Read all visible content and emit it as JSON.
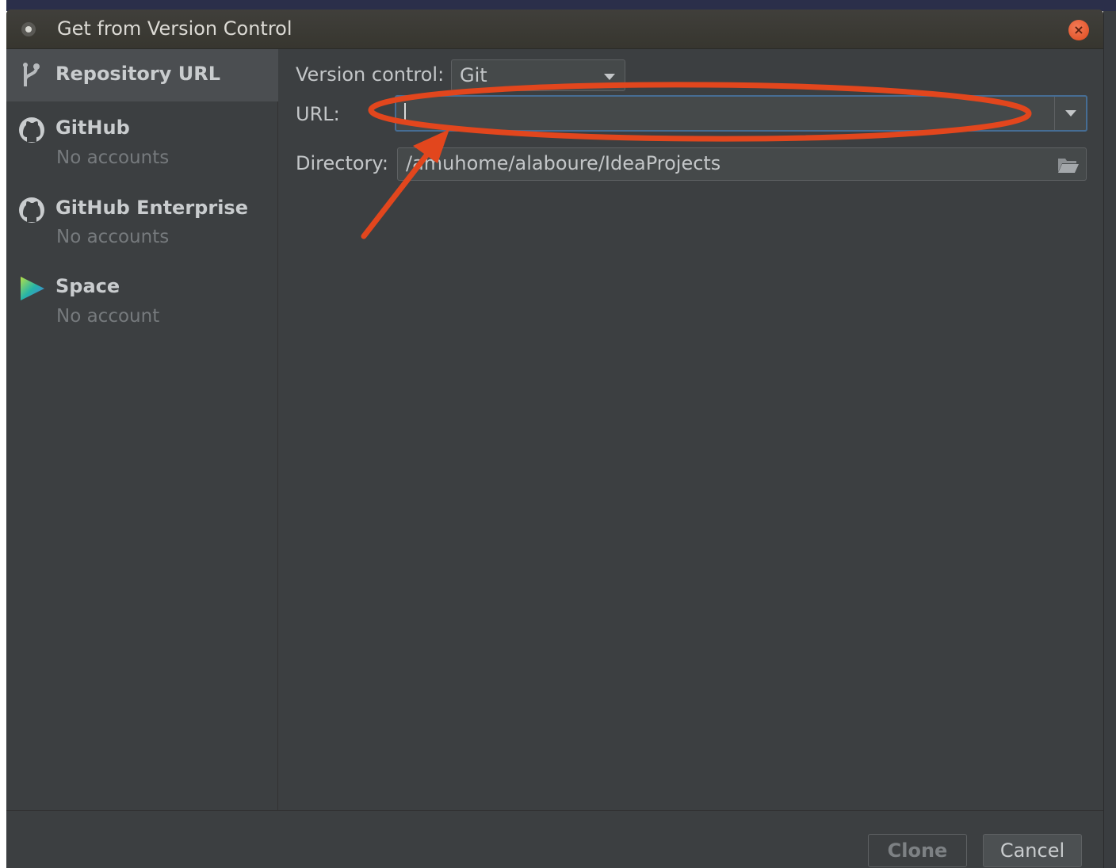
{
  "window": {
    "title": "Get from Version Control",
    "close_glyph": "×"
  },
  "sidebar": {
    "items": [
      {
        "label": "Repository URL",
        "icon": "vcs-branch-icon",
        "selected": true
      },
      {
        "label": "GitHub",
        "subtitle": "No accounts",
        "icon": "github-icon",
        "selected": false
      },
      {
        "label": "GitHub Enterprise",
        "subtitle": "No accounts",
        "icon": "github-icon",
        "selected": false
      },
      {
        "label": "Space",
        "subtitle": "No account",
        "icon": "space-icon",
        "selected": false
      }
    ]
  },
  "form": {
    "version_control_label": "Version control:",
    "version_control_value": "Git",
    "url_label": "URL:",
    "url_value": "",
    "directory_label": "Directory:",
    "directory_value": "/amuhome/alaboure/IdeaProjects"
  },
  "footer": {
    "clone_label": "Clone",
    "cancel_label": "Cancel"
  },
  "annotation": {
    "color": "#e2461d",
    "shapes": [
      "ellipse-around-url-field",
      "arrow-to-url-field"
    ]
  }
}
